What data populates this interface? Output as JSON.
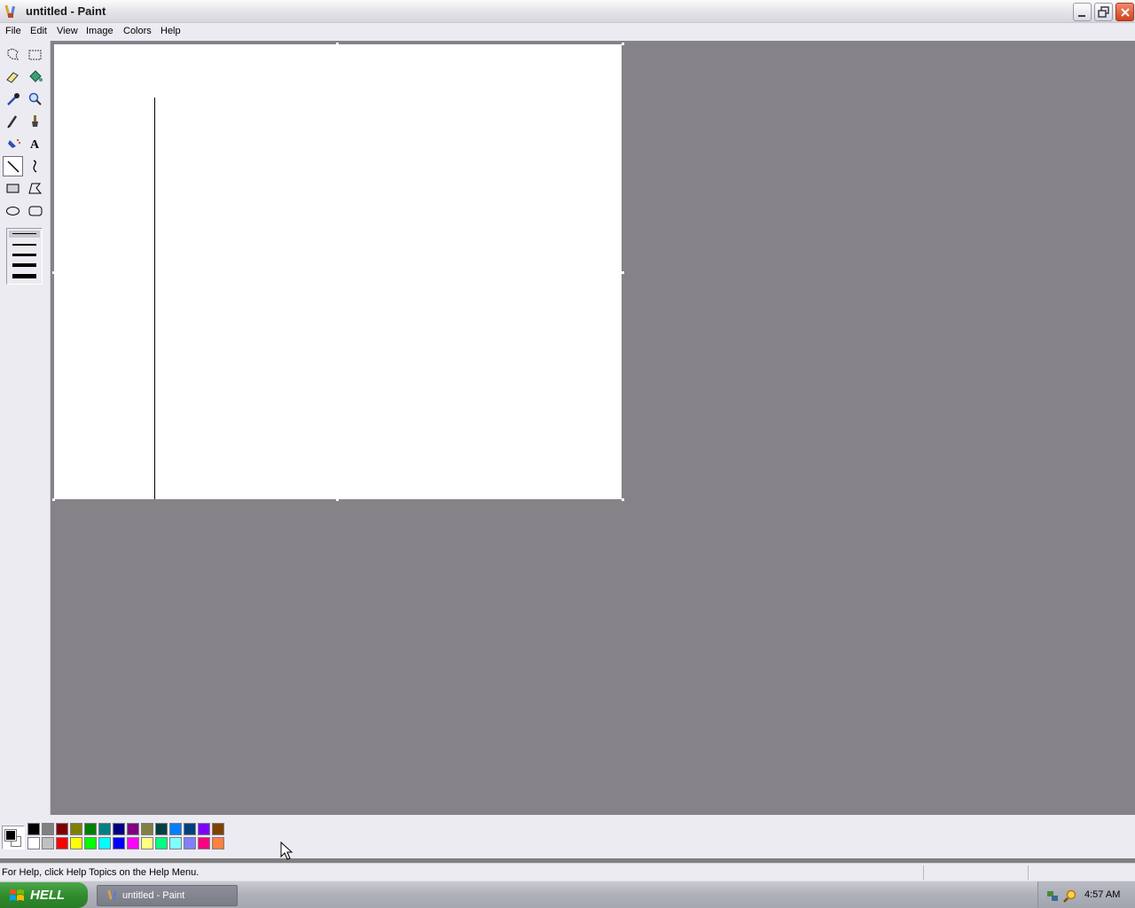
{
  "window": {
    "title": "untitled - Paint",
    "app_icon": "paint-app-icon",
    "controls": [
      "minimize-icon",
      "restore-icon",
      "close-icon"
    ]
  },
  "menu": {
    "items": [
      "File",
      "Edit",
      "View",
      "Image",
      "Colors",
      "Help"
    ]
  },
  "toolbox": {
    "tools": [
      {
        "name": "free-form-select",
        "icon": "free-form-select-icon",
        "active": false
      },
      {
        "name": "select",
        "icon": "rect-select-icon",
        "active": false
      },
      {
        "name": "eraser",
        "icon": "eraser-icon",
        "active": false
      },
      {
        "name": "fill-with-color",
        "icon": "paint-bucket-icon",
        "active": false
      },
      {
        "name": "pick-color",
        "icon": "eyedropper-icon",
        "active": false
      },
      {
        "name": "magnifier",
        "icon": "magnifier-icon",
        "active": false
      },
      {
        "name": "pencil",
        "icon": "pencil-icon",
        "active": false
      },
      {
        "name": "brush",
        "icon": "brush-icon",
        "active": false
      },
      {
        "name": "airbrush",
        "icon": "airbrush-icon",
        "active": false
      },
      {
        "name": "text",
        "icon": "text-icon",
        "active": false
      },
      {
        "name": "line",
        "icon": "line-icon",
        "active": true
      },
      {
        "name": "curve",
        "icon": "curve-icon",
        "active": false
      },
      {
        "name": "rectangle",
        "icon": "rectangle-icon",
        "active": false
      },
      {
        "name": "polygon",
        "icon": "polygon-icon",
        "active": false
      },
      {
        "name": "ellipse",
        "icon": "ellipse-icon",
        "active": false
      },
      {
        "name": "rounded-rectangle",
        "icon": "rounded-rectangle-icon",
        "active": false
      }
    ],
    "line_widths_selected_index": 0
  },
  "palette": {
    "foreground": "#000000",
    "background": "#ffffff",
    "top_row": [
      "#000000",
      "#808080",
      "#800000",
      "#808000",
      "#008000",
      "#008080",
      "#000080",
      "#800080",
      "#808040",
      "#004040",
      "#0080ff",
      "#004080",
      "#8000ff",
      "#804000"
    ],
    "bottom_row": [
      "#ffffff",
      "#c0c0c0",
      "#ff0000",
      "#ffff00",
      "#00ff00",
      "#00ffff",
      "#0000ff",
      "#ff00ff",
      "#ffff80",
      "#00ff80",
      "#80ffff",
      "#8080ff",
      "#ff0080",
      "#ff8040"
    ]
  },
  "status": {
    "help_text": "For Help, click Help Topics on the Help Menu."
  },
  "taskbar": {
    "start_label": "HELL",
    "task_label": "untitled - Paint",
    "clock": "4:57 AM"
  }
}
